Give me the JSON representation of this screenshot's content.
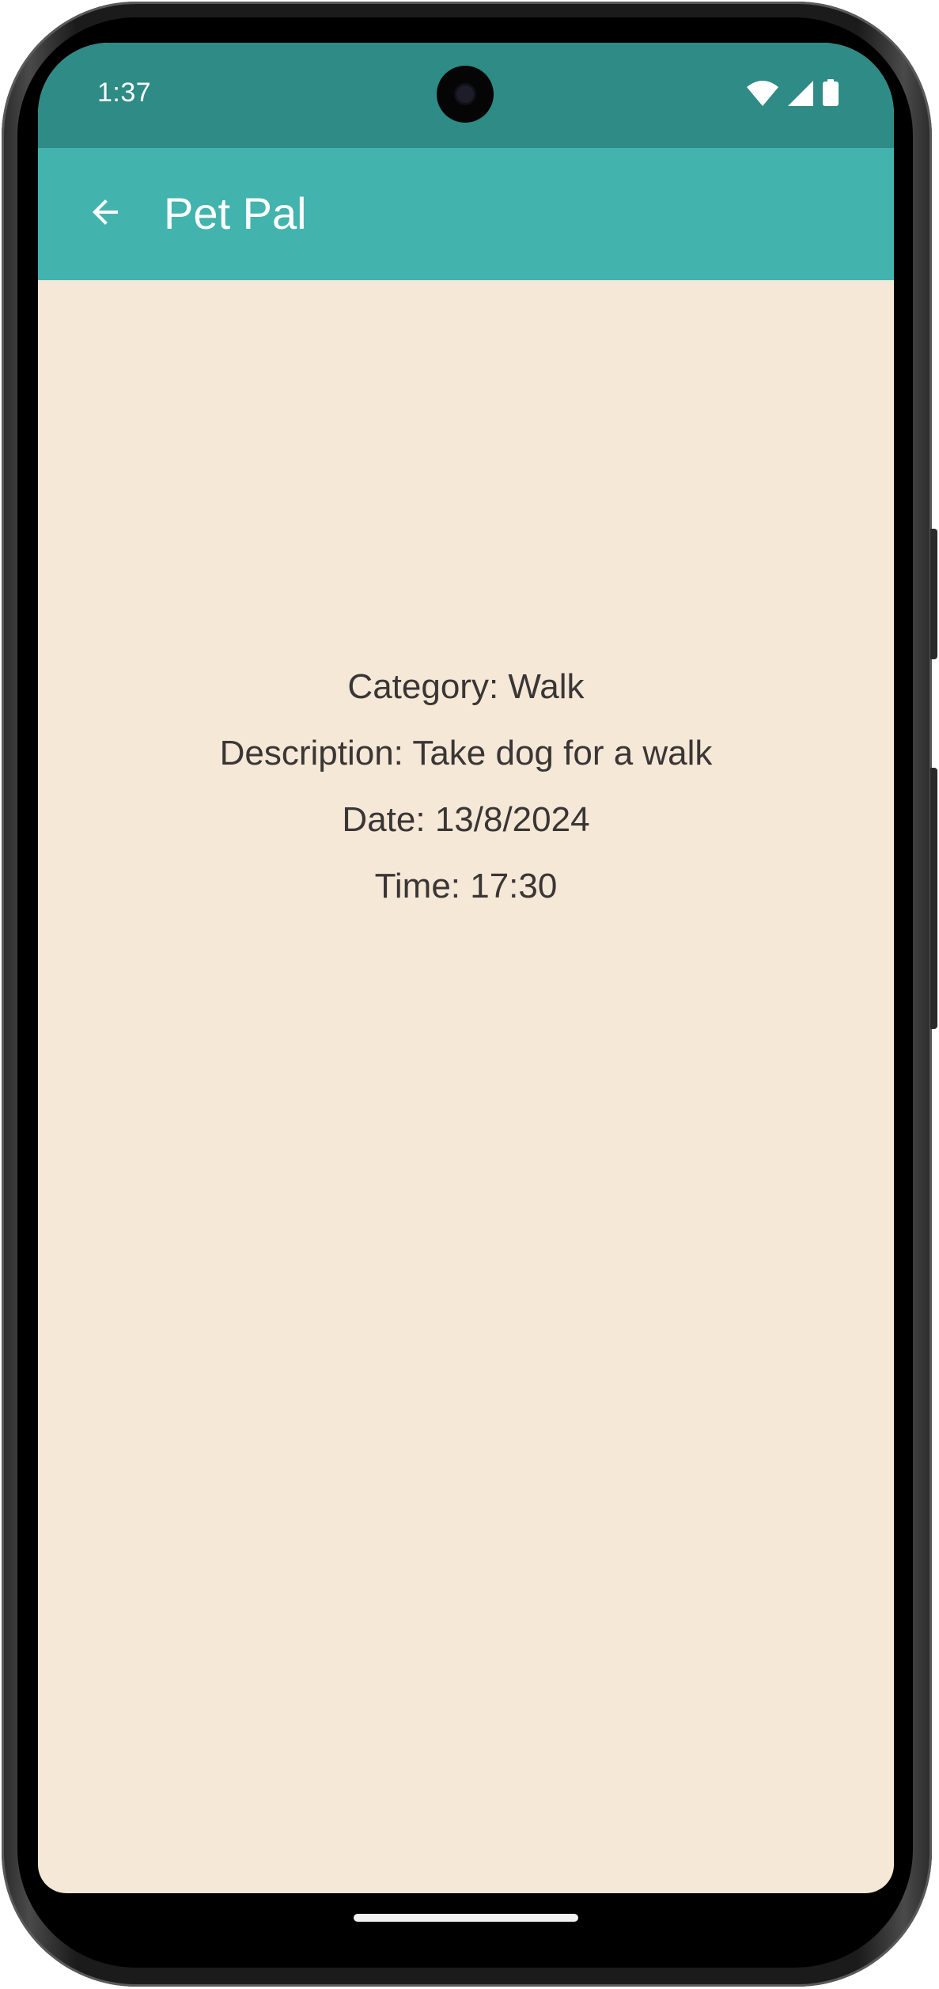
{
  "status_bar": {
    "time": "1:37",
    "icons": [
      "wifi-icon",
      "cellular-signal-icon",
      "battery-icon"
    ]
  },
  "app_bar": {
    "title": "Pet Pal",
    "back_icon": "arrow-back-icon"
  },
  "detail": {
    "category": "Category: Walk",
    "description": "Description: Take dog for a walk",
    "date": "Date: 13/8/2024",
    "time": "Time: 17:30"
  },
  "colors": {
    "status_bar_bg": "#2e8b85",
    "app_bar_bg": "#43b3ae",
    "screen_bg": "#f5e8d7",
    "text": "#3a3635"
  }
}
